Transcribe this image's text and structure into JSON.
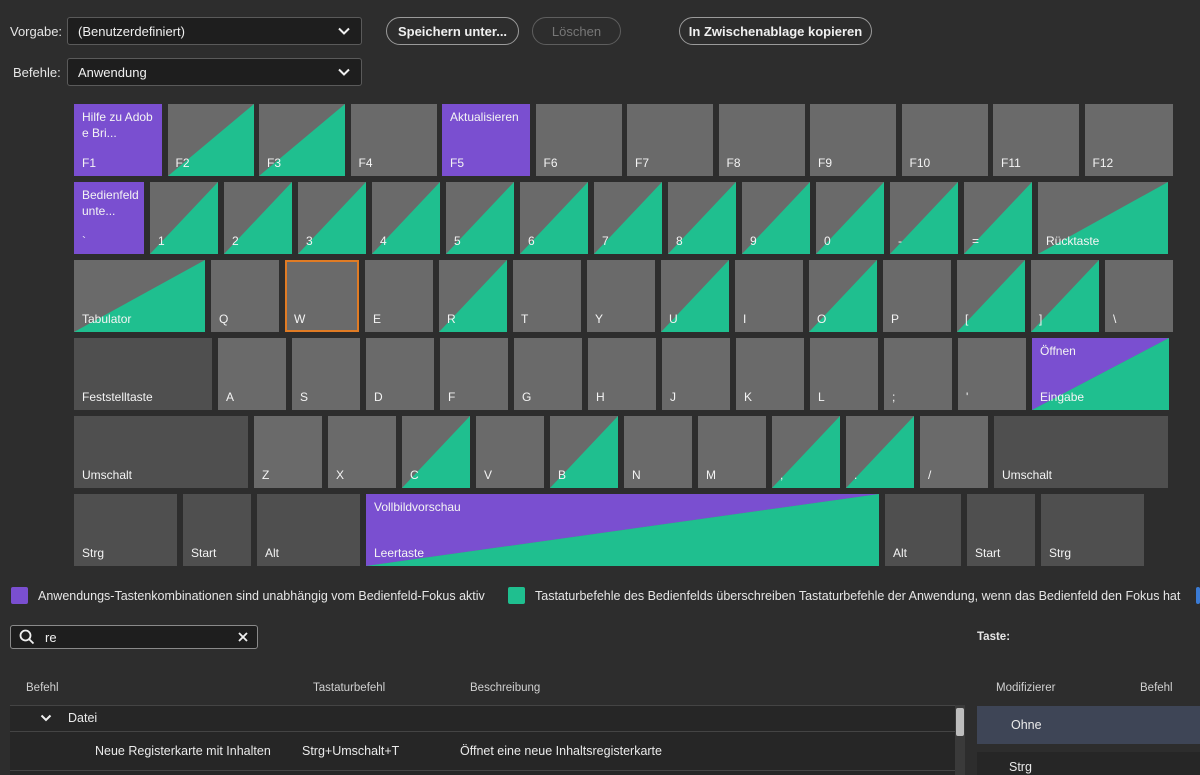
{
  "top": {
    "preset_label": "Vorgabe:",
    "preset_value": "(Benutzerdefiniert)",
    "commands_label": "Befehle:",
    "commands_value": "Anwendung",
    "save_as": "Speichern unter...",
    "delete": "Löschen",
    "copy_clipboard": "In Zwischenablage kopieren"
  },
  "keyboard": {
    "row1": [
      {
        "label": "F1",
        "cmd": "Hilfe zu Adobe Bri...",
        "type": "purple"
      },
      {
        "label": "F2",
        "type": "green"
      },
      {
        "label": "F3",
        "type": "green"
      },
      {
        "label": "F4",
        "type": "plain"
      },
      {
        "label": "F5",
        "cmd": "Aktualisieren",
        "type": "purple"
      },
      {
        "label": "F6",
        "type": "plain"
      },
      {
        "label": "F7",
        "type": "plain"
      },
      {
        "label": "F8",
        "type": "plain"
      },
      {
        "label": "F9",
        "type": "plain"
      },
      {
        "label": "F10",
        "type": "plain"
      },
      {
        "label": "F11",
        "type": "plain"
      },
      {
        "label": "F12",
        "type": "plain"
      }
    ],
    "row2": [
      {
        "label": "`",
        "cmd": "Bedienfeld unte...",
        "type": "purple"
      },
      {
        "label": "1",
        "type": "green"
      },
      {
        "label": "2",
        "type": "green"
      },
      {
        "label": "3",
        "type": "green"
      },
      {
        "label": "4",
        "type": "green"
      },
      {
        "label": "5",
        "type": "green"
      },
      {
        "label": "6",
        "type": "green"
      },
      {
        "label": "7",
        "type": "green"
      },
      {
        "label": "8",
        "type": "green"
      },
      {
        "label": "9",
        "type": "green"
      },
      {
        "label": "0",
        "type": "green"
      },
      {
        "label": "-",
        "type": "green"
      },
      {
        "label": "=",
        "type": "green"
      },
      {
        "label": "Rücktaste",
        "type": "green"
      }
    ],
    "row3": [
      {
        "label": "Tabulator",
        "type": "green"
      },
      {
        "label": "Q",
        "type": "plain"
      },
      {
        "label": "W",
        "type": "selected"
      },
      {
        "label": "E",
        "type": "plain"
      },
      {
        "label": "R",
        "type": "green"
      },
      {
        "label": "T",
        "type": "plain"
      },
      {
        "label": "Y",
        "type": "plain"
      },
      {
        "label": "U",
        "type": "green"
      },
      {
        "label": "I",
        "type": "plain"
      },
      {
        "label": "O",
        "type": "green"
      },
      {
        "label": "P",
        "type": "plain"
      },
      {
        "label": "[",
        "type": "green"
      },
      {
        "label": "]",
        "type": "green"
      },
      {
        "label": "\\",
        "type": "plain"
      }
    ],
    "row4": [
      {
        "label": "Feststelltaste",
        "type": "dark"
      },
      {
        "label": "A",
        "type": "plain"
      },
      {
        "label": "S",
        "type": "plain"
      },
      {
        "label": "D",
        "type": "plain"
      },
      {
        "label": "F",
        "type": "plain"
      },
      {
        "label": "G",
        "type": "plain"
      },
      {
        "label": "H",
        "type": "plain"
      },
      {
        "label": "J",
        "type": "plain"
      },
      {
        "label": "K",
        "type": "plain"
      },
      {
        "label": "L",
        "type": "plain"
      },
      {
        "label": ";",
        "type": "plain"
      },
      {
        "label": "'",
        "type": "plain"
      },
      {
        "label": "Eingabe",
        "cmd": "Öffnen",
        "type": "both"
      }
    ],
    "row5": [
      {
        "label": "Umschalt",
        "type": "dark"
      },
      {
        "label": "Z",
        "type": "plain"
      },
      {
        "label": "X",
        "type": "plain"
      },
      {
        "label": "C",
        "type": "green"
      },
      {
        "label": "V",
        "type": "plain"
      },
      {
        "label": "B",
        "type": "green"
      },
      {
        "label": "N",
        "type": "plain"
      },
      {
        "label": "M",
        "type": "plain"
      },
      {
        "label": ",",
        "type": "green"
      },
      {
        "label": ".",
        "type": "green"
      },
      {
        "label": "/",
        "type": "plain"
      },
      {
        "label": "Umschalt",
        "type": "dark"
      }
    ],
    "row6": [
      {
        "label": "Strg",
        "type": "dark"
      },
      {
        "label": "Start",
        "type": "dark"
      },
      {
        "label": "Alt",
        "type": "dark"
      },
      {
        "label": "Leertaste",
        "cmd": "Vollbildvorschau",
        "type": "both"
      },
      {
        "label": "Alt",
        "type": "dark"
      },
      {
        "label": "Start",
        "type": "dark"
      },
      {
        "label": "Strg",
        "type": "dark"
      }
    ]
  },
  "legend": {
    "purple_text": "Anwendungs-Tastenkombinationen sind unabhängig vom Bedienfeld-Fokus aktiv",
    "green_text": "Tastaturbefehle des Bedienfelds überschreiben Tastaturbefehle der Anwendung, wenn das Bedienfeld den Fokus hat"
  },
  "colors": {
    "purple": "#7a4fd0",
    "green": "#1fbf8f",
    "key_gray": "#6a6a6a",
    "selection_orange": "#e07b24"
  },
  "search": {
    "value": "re"
  },
  "table": {
    "col_command": "Befehl",
    "col_shortcut": "Tastaturbefehl",
    "col_description": "Beschreibung",
    "group": "Datei",
    "rows": [
      {
        "command": "Neue Registerkarte mit Inhalten",
        "shortcut": "Strg+Umschalt+T",
        "description": "Öffnet eine neue Inhaltsregisterkarte"
      }
    ]
  },
  "right_panel": {
    "key_label": "Taste:",
    "col_modifier": "Modifizierer",
    "col_command": "Befehl",
    "modifiers": [
      "Ohne",
      "Strg"
    ]
  }
}
